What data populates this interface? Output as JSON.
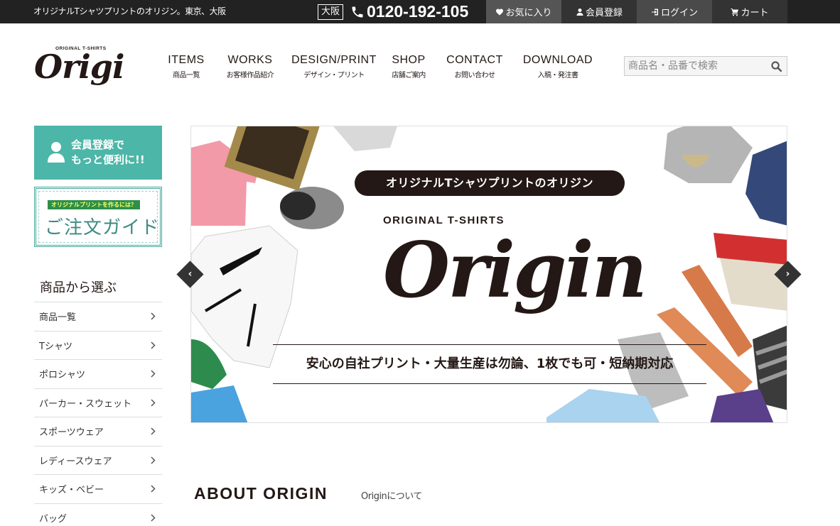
{
  "topbar": {
    "tagline": "オリジナルTシャツプリントのオリジン。東京、大阪",
    "region": "大阪",
    "phone": "0120-192-105",
    "links": [
      {
        "label": "お気に入り",
        "icon": "heart-icon"
      },
      {
        "label": "会員登録",
        "icon": "user-icon"
      },
      {
        "label": "ログイン",
        "icon": "login-icon"
      },
      {
        "label": "カート",
        "icon": "cart-icon"
      }
    ]
  },
  "header": {
    "logo_top": "ORIGINAL T-SHIRTS",
    "logo_main": "Origin",
    "nav": [
      {
        "en": "ITEMS",
        "ja": "商品一覧"
      },
      {
        "en": "WORKS",
        "ja": "お客様作品紹介"
      },
      {
        "en": "DESIGN/PRINT",
        "ja": "デザイン・プリント"
      },
      {
        "en": "SHOP",
        "ja": "店舗ご案内"
      },
      {
        "en": "CONTACT",
        "ja": "お問い合わせ"
      },
      {
        "en": "DOWNLOAD",
        "ja": "入稿・発注書"
      }
    ],
    "search_placeholder": "商品名・品番で検索"
  },
  "sidebar": {
    "member_banner": {
      "line1": "会員登録で",
      "line2": "もっと便利に!!"
    },
    "guide_banner": {
      "sub": "オリジナルプリントを作るには？",
      "title": "ご注文ガイド"
    },
    "category_heading": "商品から選ぶ",
    "categories": [
      {
        "label": "商品一覧"
      },
      {
        "label": "Tシャツ"
      },
      {
        "label": "ポロシャツ"
      },
      {
        "label": "パーカー・スウェット"
      },
      {
        "label": "スポーツウェア"
      },
      {
        "label": "レディースウェア"
      },
      {
        "label": "キッズ・ベビー"
      },
      {
        "label": "バッグ"
      }
    ]
  },
  "hero": {
    "pill": "オリジナルTシャツプリントのオリジン",
    "logo_top": "ORIGINAL T-SHIRTS",
    "logo_main": "Origin",
    "tagline": "安心の自社プリント・大量生産は勿論、1枚でも可・短納期対応",
    "prev_icon": "chevron-left-icon",
    "next_icon": "chevron-right-icon"
  },
  "about": {
    "title": "ABOUT ORIGIN",
    "sub": "Originについて"
  },
  "colors": {
    "topbar": "#222222",
    "accent_teal": "#4cb6a8",
    "brand_dark": "#231815",
    "stripe_yellow": "#ffe066"
  }
}
